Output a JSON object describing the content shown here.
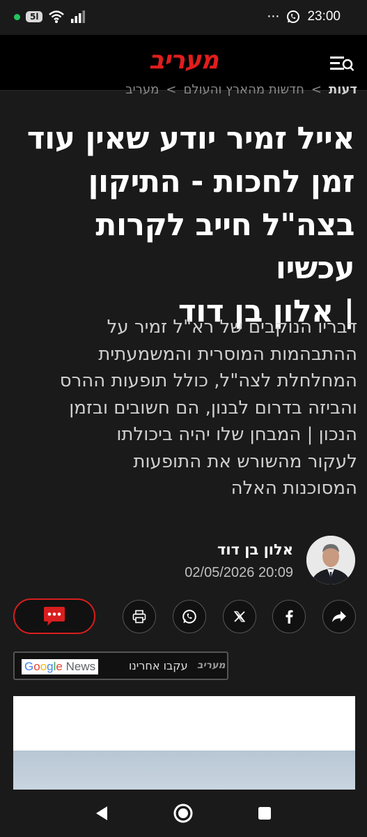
{
  "status_bar": {
    "sim_label": "5l",
    "overflow": "···",
    "time": "23:00"
  },
  "header": {
    "logo": "מעריב",
    "menu_icon": "search-menu-icon"
  },
  "breadcrumb": {
    "items": [
      "מעריב",
      "חדשות מהארץ והעולם",
      "דעות"
    ],
    "separator": ">"
  },
  "article": {
    "headline_lines": [
      "אייל זמיר יודע שאין עוד",
      "זמן לחכות - התיקון",
      "בצה\"ל חייב לקרות עכשיו",
      "| אלון בן דוד"
    ],
    "subtitle_lines": [
      "דבריו הנוקבים של רא\"ל זמיר על",
      "ההתבהמות המוסרית והמשמעתית",
      "המחלחלת לצה\"ל, כולל תופעות ההרס",
      "והביזה בדרום לבנון, הם חשובים ובזמן",
      "הנכון | המבחן שלו יהיה ביכולתו",
      "לעקור מהשורש את התופעות",
      "המסוכנות האלה"
    ],
    "author": "אלון בן דוד",
    "date": "02/05/2026 20:09"
  },
  "share": {
    "buttons": [
      "comments-icon",
      "print-icon",
      "whatsapp-icon",
      "x-icon",
      "facebook-icon",
      "share-icon"
    ]
  },
  "google_news": {
    "logo_text": "Google News",
    "follow_text": "עקבו אחרינו",
    "brand": "מעריב"
  },
  "colors": {
    "accent": "#d81e1e",
    "logo": "#e11d1d",
    "background": "#1a1a1a"
  }
}
